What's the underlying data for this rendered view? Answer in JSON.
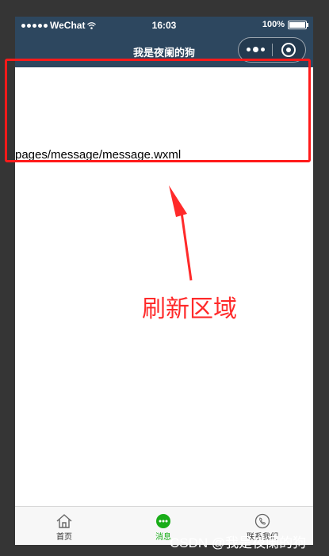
{
  "status_bar": {
    "carrier": "WeChat",
    "time": "16:03",
    "battery": "100%"
  },
  "nav_bar": {
    "title": "我是夜阑的狗"
  },
  "page": {
    "path_text": "pages/message/message.wxml"
  },
  "tab_bar": {
    "items": [
      {
        "label": "首页",
        "icon": "home-icon",
        "active": false
      },
      {
        "label": "消息",
        "icon": "message-icon",
        "active": true
      },
      {
        "label": "联系我们",
        "icon": "phone-icon",
        "active": false
      }
    ]
  },
  "annotation": {
    "label": "刷新区域",
    "color": "#ff2a2a"
  },
  "watermark": {
    "text": "CSDN @我是夜阑的狗"
  },
  "colors": {
    "nav_background": "#2d475f",
    "tab_active": "#1aad19",
    "highlight": "#ff1a1a"
  }
}
